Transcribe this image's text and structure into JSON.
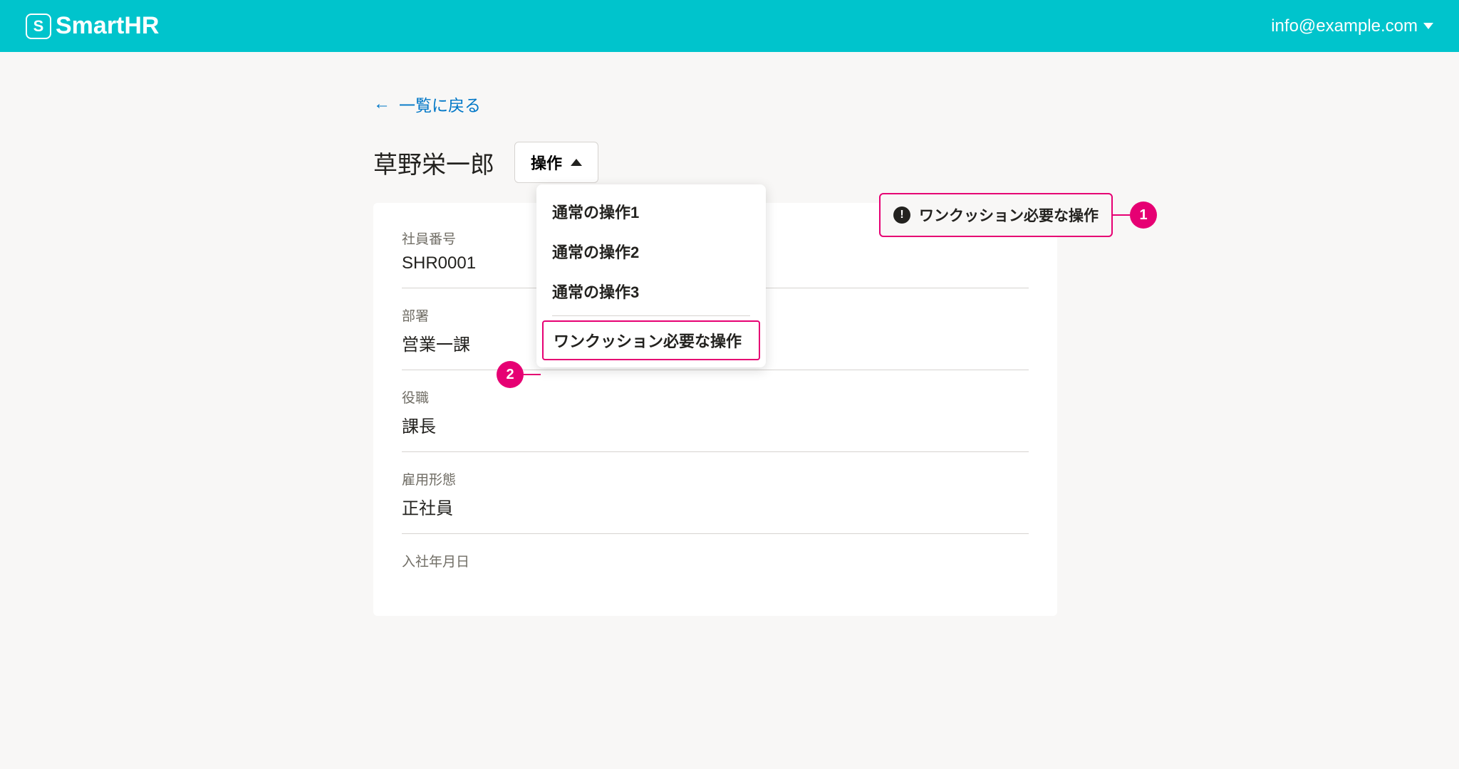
{
  "header": {
    "brand_prefix": "Smart",
    "brand_suffix": "HR",
    "logo_letter": "S",
    "user_email": "info@example.com"
  },
  "nav": {
    "back_label": "一覧に戻る"
  },
  "page": {
    "title": "草野栄一郎",
    "action_button_label": "操作"
  },
  "dropdown": {
    "items": [
      {
        "label": "通常の操作1"
      },
      {
        "label": "通常の操作2"
      },
      {
        "label": "通常の操作3"
      }
    ],
    "highlighted_label": "ワンクッション必要な操作"
  },
  "callout": {
    "text": "ワンクッション必要な操作",
    "badge1": "1",
    "badge2": "2"
  },
  "fields": [
    {
      "label": "社員番号",
      "value": "SHR0001"
    },
    {
      "label": "部署",
      "value": "営業一課"
    },
    {
      "label": "役職",
      "value": "課長"
    },
    {
      "label": "雇用形態",
      "value": "正社員"
    },
    {
      "label": "入社年月日",
      "value": ""
    }
  ],
  "colors": {
    "primary": "#00c4cc",
    "link": "#0077c7",
    "accent": "#e60073"
  }
}
